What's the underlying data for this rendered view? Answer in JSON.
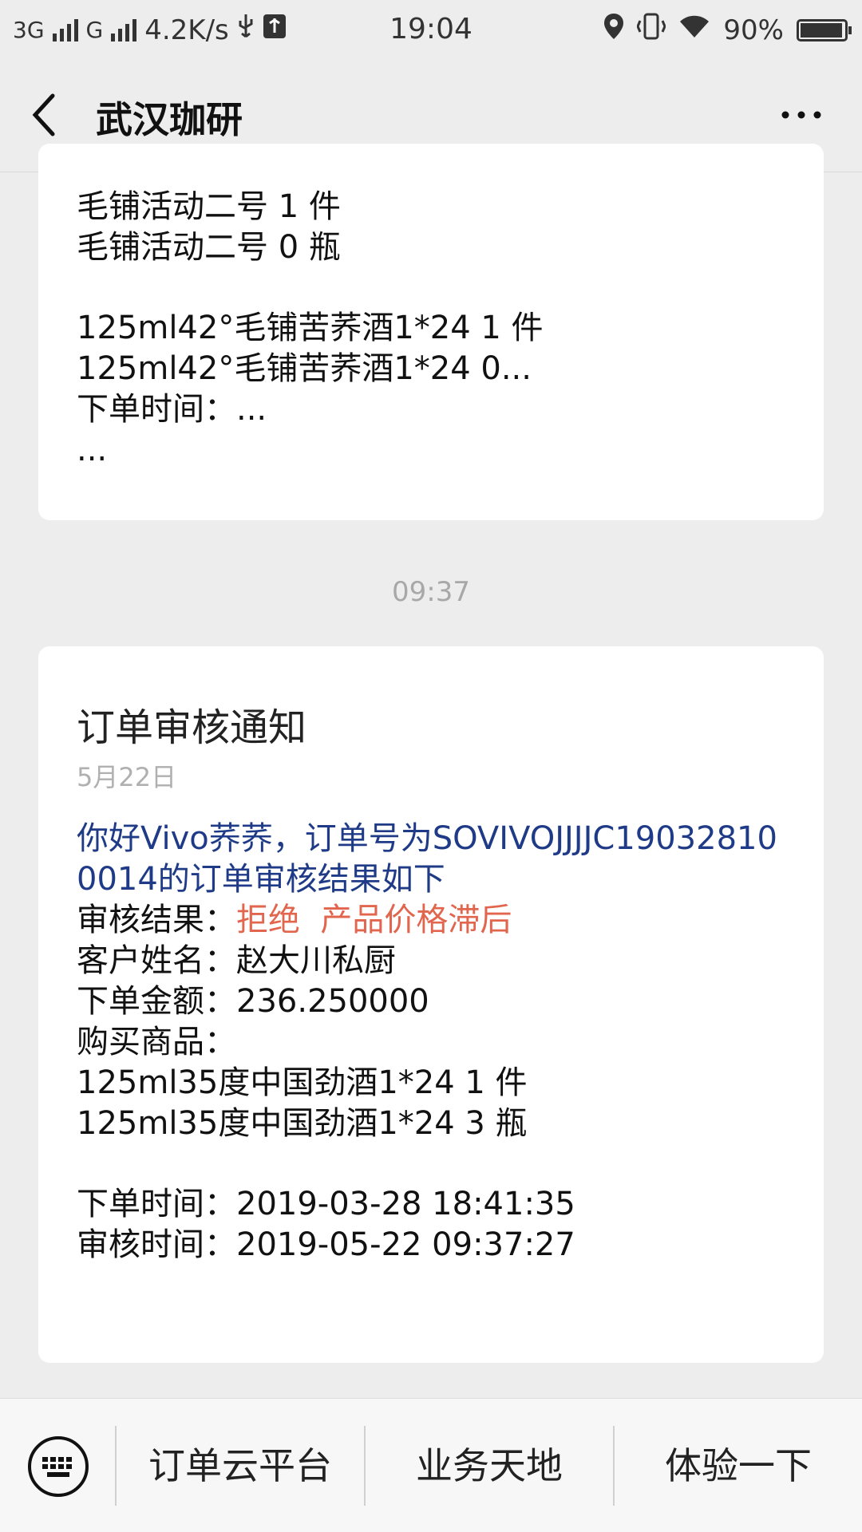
{
  "status_bar": {
    "network1": "3G",
    "network2": "G",
    "speed": "4.2K/s",
    "time": "19:04",
    "battery": "90%",
    "icons": [
      "usb-icon",
      "settings-usb-icon",
      "location-icon",
      "vibrate-icon",
      "wifi-icon",
      "battery-icon"
    ]
  },
  "nav": {
    "title": "武汉珈研",
    "back_icon": "back-chevron-icon",
    "more_icon": "more-dots-icon"
  },
  "messages": [
    {
      "lines": [
        "毛铺活动二号 1 件",
        "毛铺活动二号 0 瓶",
        "",
        "125ml42°毛铺苦荞酒1*24 1 件",
        "125ml42°毛铺苦荞酒1*24 0...",
        "下单时间：...",
        "..."
      ]
    },
    {
      "timestamp": "09:37",
      "title": "订单审核通知",
      "date": "5月22日",
      "intro": "你好Vivo荞荞，订单号为SOVIVOJJJJC190328100014的订单审核结果如下",
      "result_label": "审核结果：",
      "result_value": "拒绝  产品价格滞后",
      "customer_label": "客户姓名：",
      "customer_value": "赵大川私厨",
      "amount_label": "下单金额：",
      "amount_value": "236.250000",
      "goods_label": "购买商品：",
      "goods": [
        "125ml35度中国劲酒1*24 1 件",
        "125ml35度中国劲酒1*24 3 瓶"
      ],
      "order_time_label": "下单时间：",
      "order_time_value": "2019-03-28 18:41:35",
      "review_time_label": "审核时间：",
      "review_time_value": "2019-05-22 09:37:27"
    }
  ],
  "bottom_menu": {
    "keyboard_icon": "keyboard-icon",
    "items": [
      "订单云平台",
      "业务天地",
      "体验一下"
    ]
  },
  "colors": {
    "link_blue": "#1f3b87",
    "reject_red": "#e2654e",
    "background": "#ededed"
  }
}
